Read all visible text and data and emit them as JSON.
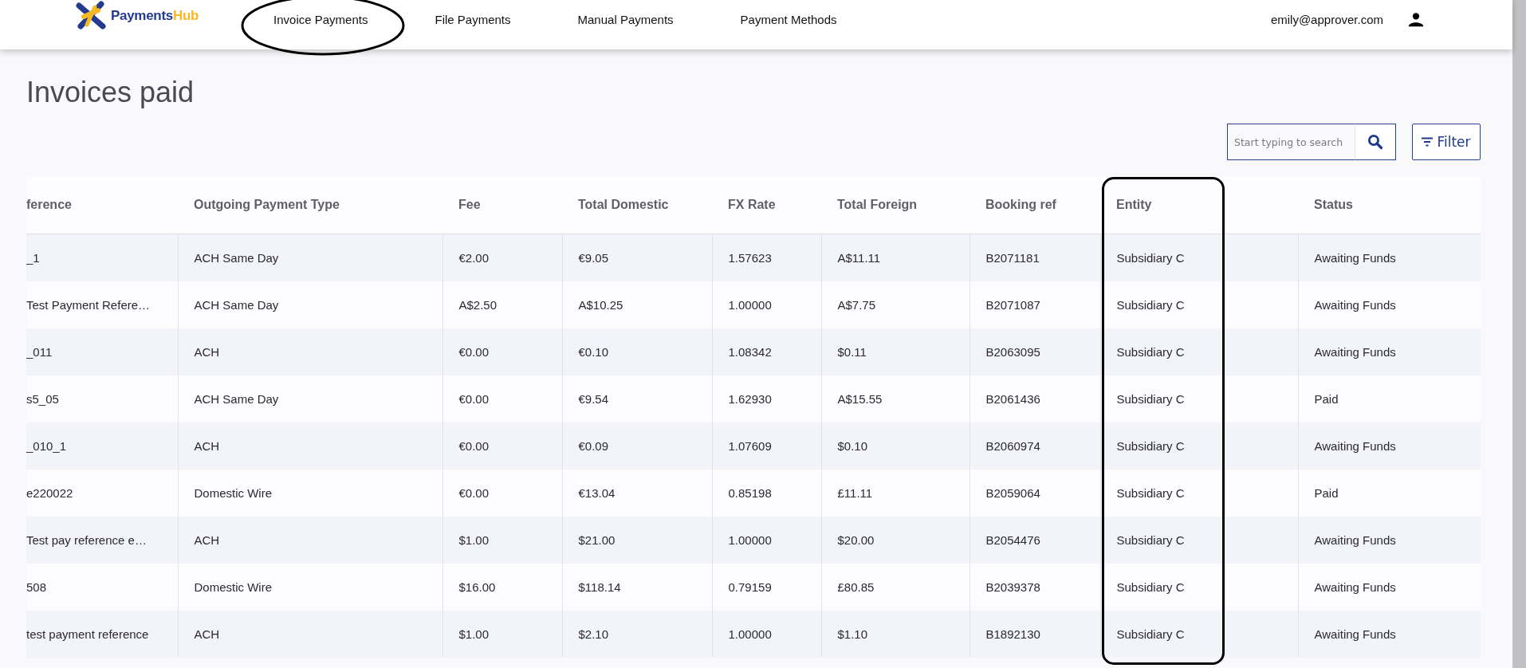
{
  "brand": {
    "part_1": "Payments",
    "part_2": "Hub"
  },
  "nav": [
    {
      "label": "Invoice Payments",
      "circled": true
    },
    {
      "label": "File Payments",
      "circled": false
    },
    {
      "label": "Manual Payments",
      "circled": false
    },
    {
      "label": "Payment Methods",
      "circled": false
    }
  ],
  "user": {
    "email": "emily@approver.com"
  },
  "page_title": "Invoices paid",
  "search": {
    "placeholder": "Start typing to search"
  },
  "filter_button": "Filter",
  "table": {
    "columns": [
      {
        "label": "ference",
        "boxed": false
      },
      {
        "label": "Outgoing Payment Type",
        "boxed": false
      },
      {
        "label": "Fee",
        "boxed": false
      },
      {
        "label": "Total Domestic",
        "boxed": false
      },
      {
        "label": "FX Rate",
        "boxed": false
      },
      {
        "label": "Total Foreign",
        "boxed": false
      },
      {
        "label": "Booking ref",
        "boxed": false
      },
      {
        "label": "Entity",
        "boxed": true
      },
      {
        "label": "Status",
        "boxed": false
      }
    ],
    "rows": [
      [
        "_1",
        "ACH Same Day",
        "€2.00",
        "€9.05",
        "1.57623",
        "A$11.11",
        "B2071181",
        "Subsidiary C",
        "Awaiting Funds"
      ],
      [
        "Test Payment Refere…",
        "ACH Same Day",
        "A$2.50",
        "A$10.25",
        "1.00000",
        "A$7.75",
        "B2071087",
        "Subsidiary C",
        "Awaiting Funds"
      ],
      [
        "_011",
        "ACH",
        "€0.00",
        "€0.10",
        "1.08342",
        "$0.11",
        "B2063095",
        "Subsidiary C",
        "Awaiting Funds"
      ],
      [
        "s5_05",
        "ACH Same Day",
        "€0.00",
        "€9.54",
        "1.62930",
        "A$15.55",
        "B2061436",
        "Subsidiary C",
        "Paid"
      ],
      [
        "_010_1",
        "ACH",
        "€0.00",
        "€0.09",
        "1.07609",
        "$0.10",
        "B2060974",
        "Subsidiary C",
        "Awaiting Funds"
      ],
      [
        "e220022",
        "Domestic Wire",
        "€0.00",
        "€13.04",
        "0.85198",
        "£11.11",
        "B2059064",
        "Subsidiary C",
        "Paid"
      ],
      [
        "Test pay reference e…",
        "ACH",
        "$1.00",
        "$21.00",
        "1.00000",
        "$20.00",
        "B2054476",
        "Subsidiary C",
        "Awaiting Funds"
      ],
      [
        "508",
        "Domestic Wire",
        "$16.00",
        "$118.14",
        "0.79159",
        "£80.85",
        "B2039378",
        "Subsidiary C",
        "Awaiting Funds"
      ],
      [
        "test payment reference",
        "ACH",
        "$1.00",
        "$2.10",
        "1.00000",
        "$1.10",
        "B1892130",
        "Subsidiary C",
        "Awaiting Funds"
      ]
    ]
  }
}
